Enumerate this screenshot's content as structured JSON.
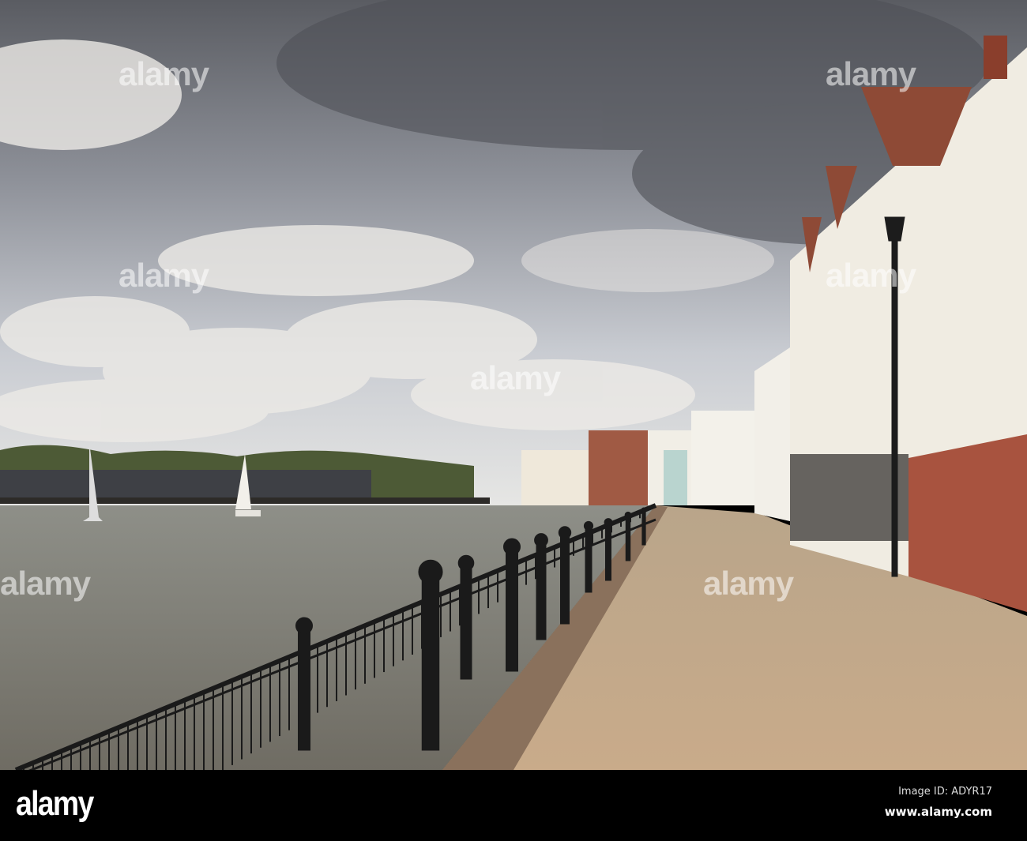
{
  "watermark": {
    "text": "alamy"
  },
  "footer": {
    "logo": "alamy",
    "image_id": "Image ID: ADYR17",
    "url": "www.alamy.com"
  }
}
